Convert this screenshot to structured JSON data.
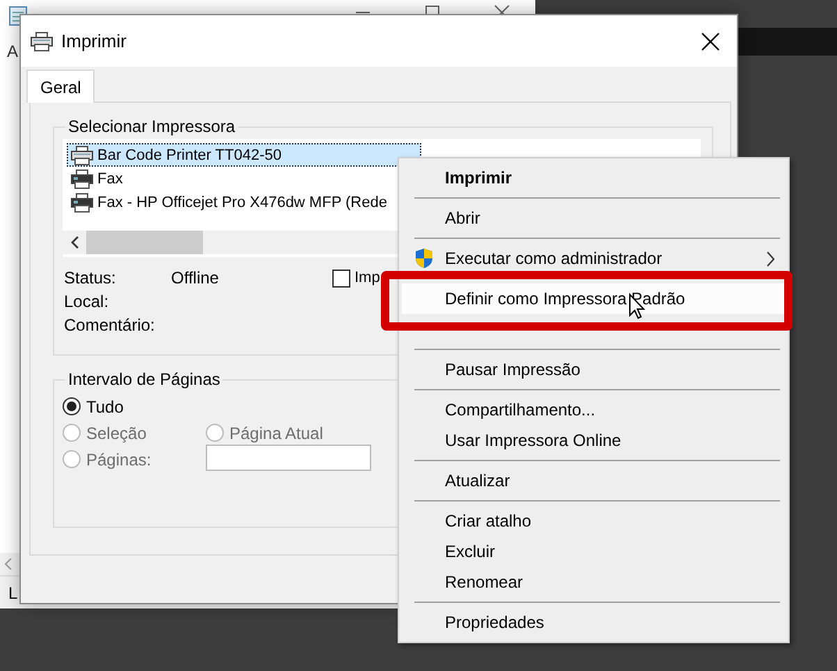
{
  "background_window": {
    "menu_text": "A",
    "status_text": "L"
  },
  "dialog": {
    "title": "Imprimir",
    "tabs": [
      {
        "label": "Geral",
        "selected": true
      }
    ],
    "printer_group": {
      "title": "Selecionar Impressora",
      "columns": [
        [
          {
            "name": "Bar Code Printer TT042-50",
            "selected": true
          },
          {
            "name": "Fax",
            "selected": false
          },
          {
            "name": "Fax - HP Officejet Pro X476dw MFP (Rede",
            "selected": false
          }
        ]
      ],
      "details": [
        {
          "label": "Status:",
          "value": "Offline"
        },
        {
          "label": "Local:"
        },
        {
          "label": "Comentário:"
        }
      ],
      "print_to_file": {
        "label": "Imp",
        "checked": false
      }
    },
    "page_range": {
      "title": "Intervalo de Páginas",
      "options": [
        {
          "label": "Tudo",
          "selected": true,
          "disabled": false
        },
        {
          "label": "Seleção",
          "selected": false,
          "disabled": true
        },
        {
          "label": "Página Atual",
          "selected": false,
          "disabled": true
        },
        {
          "label": "Páginas:",
          "selected": false,
          "disabled": true
        }
      ]
    }
  },
  "context_menu": {
    "items": [
      {
        "kind": "item",
        "label": "Imprimir",
        "bold": true,
        "selected": false
      },
      {
        "kind": "separator"
      },
      {
        "kind": "item",
        "label": "Abrir",
        "selected": false
      },
      {
        "kind": "separator"
      },
      {
        "kind": "item",
        "label": "Executar como administrador",
        "elevated": true,
        "submenu": true,
        "selected": false
      },
      {
        "kind": "separator"
      },
      {
        "kind": "item",
        "label": "Definir como Impressora Padrão",
        "selected": true
      },
      {
        "kind": "covered"
      },
      {
        "kind": "separator"
      },
      {
        "kind": "item",
        "label": "Pausar Impressão",
        "selected": false
      },
      {
        "kind": "separator"
      },
      {
        "kind": "item",
        "label": "Compartilhamento...",
        "selected": false
      },
      {
        "kind": "item",
        "label": "Usar Impressora Online",
        "selected": false
      },
      {
        "kind": "separator"
      },
      {
        "kind": "item",
        "label": "Atualizar",
        "selected": false
      },
      {
        "kind": "separator"
      },
      {
        "kind": "item",
        "label": "Criar atalho",
        "selected": false
      },
      {
        "kind": "item",
        "label": "Excluir",
        "selected": false
      },
      {
        "kind": "item",
        "label": "Renomear",
        "selected": false
      },
      {
        "kind": "separator"
      },
      {
        "kind": "item",
        "label": "Propriedades",
        "selected": false
      }
    ]
  }
}
